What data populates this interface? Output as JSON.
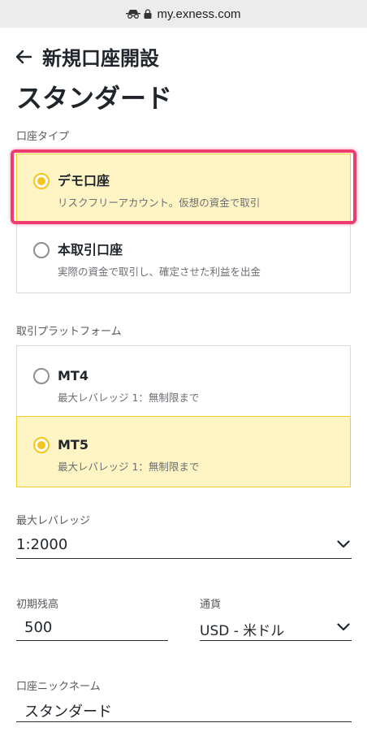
{
  "browser": {
    "url": "my.exness.com"
  },
  "header": {
    "back_title": "新規口座開設",
    "title": "スタンダード"
  },
  "account_type": {
    "label": "口座タイプ",
    "options": [
      {
        "title": "デモ口座",
        "subtitle": "リスクフリーアカウント。仮想の資金で取引",
        "selected": true
      },
      {
        "title": "本取引口座",
        "subtitle": "実際の資金で取引し、確定させた利益を出金",
        "selected": false
      }
    ]
  },
  "platform": {
    "label": "取引プラットフォーム",
    "options": [
      {
        "title": "MT4",
        "subtitle": "最大レバレッジ 1：無制限まで",
        "selected": false
      },
      {
        "title": "MT5",
        "subtitle": "最大レバレッジ 1：無制限まで",
        "selected": true
      }
    ]
  },
  "leverage": {
    "label": "最大レバレッジ",
    "value": "1:2000"
  },
  "initial_balance": {
    "label": "初期残高",
    "value": "500"
  },
  "currency": {
    "label": "通貨",
    "value": "USD - 米ドル"
  },
  "nickname": {
    "label": "口座ニックネーム",
    "value": "スタンダード"
  },
  "colors": {
    "accent": "#f4c51f",
    "selected_bg": "#fff4c4",
    "highlight": "#ee3c6f"
  }
}
